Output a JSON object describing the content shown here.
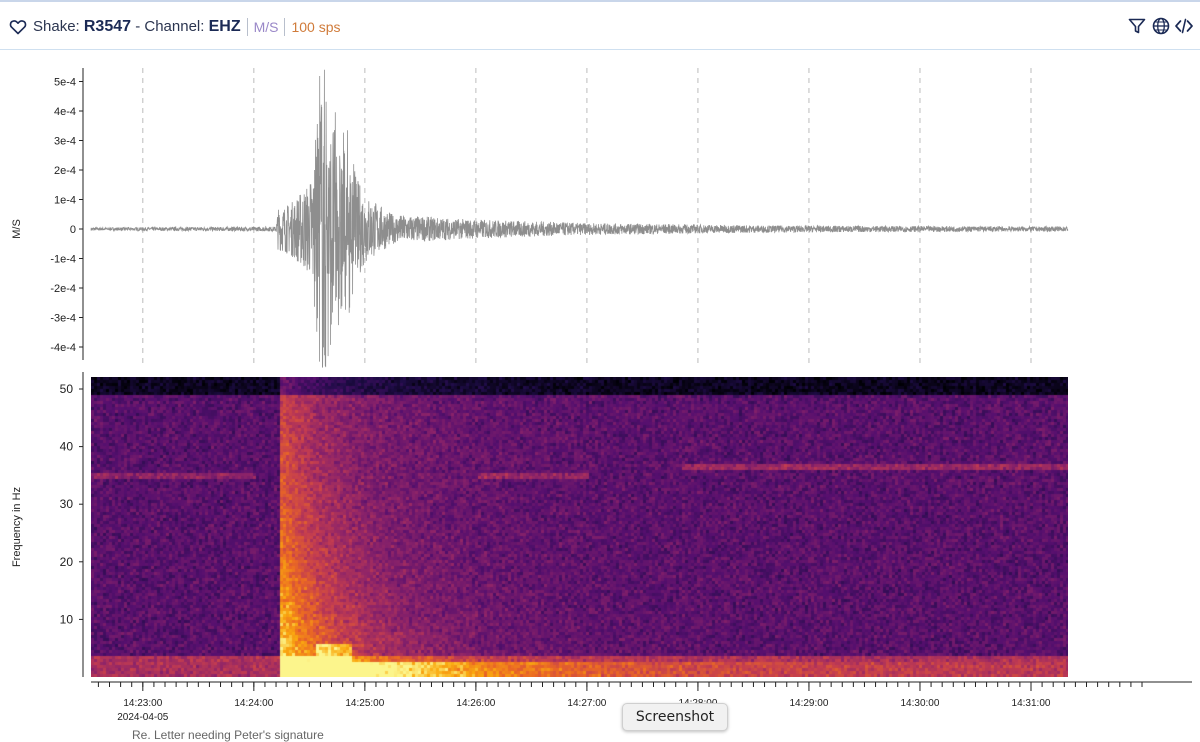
{
  "header": {
    "shake_label": "Shake:",
    "station": "R3547",
    "channel_label": "- Channel:",
    "channel": "EHZ",
    "unit": "M/S",
    "sample_rate": "100 sps"
  },
  "icons": {
    "favorite": "heart-icon",
    "filter": "filter-icon",
    "locate": "globe-icon",
    "embed": "code-icon"
  },
  "tooltip": "Screenshot",
  "bottom_partial_text": "Re. Letter needing Peter's signature",
  "colors": {
    "trace": "#8e8e8e",
    "grid": "#bcbcbc",
    "accent": "#1b2a55",
    "unit": "#9a88c8",
    "sps": "#d07b3a"
  },
  "chart_data": [
    {
      "type": "line",
      "ylabel": "M/S",
      "yticks": [
        "5e-4",
        "4e-4",
        "3e-4",
        "2e-4",
        "1e-4",
        "0",
        "-1e-4",
        "-2e-4",
        "-3e-4",
        "-4e-4"
      ],
      "ytick_values": [
        0.0005,
        0.0004,
        0.0003,
        0.0002,
        0.0001,
        0,
        -0.0001,
        -0.0002,
        -0.0003,
        -0.0004
      ],
      "ylim": [
        -0.00048,
        0.00055
      ],
      "x_range_seconds_after_14_22_00": [
        32,
        560
      ],
      "series": [
        {
          "envelope": [
            {
              "t": 32,
              "amp": 5e-06
            },
            {
              "t": 132,
              "amp": 8e-06
            },
            {
              "t": 133,
              "amp": 7e-05
            },
            {
              "t": 140,
              "amp": 9e-05
            },
            {
              "t": 150,
              "amp": 0.00016
            },
            {
              "t": 152,
              "amp": 0.00022
            },
            {
              "t": 155,
              "amp": 0.00045
            },
            {
              "t": 158,
              "amp": 0.00055
            },
            {
              "t": 162,
              "amp": 0.00035
            },
            {
              "t": 170,
              "amp": 0.00025
            },
            {
              "t": 180,
              "amp": 0.00012
            },
            {
              "t": 195,
              "amp": 5e-05
            },
            {
              "t": 230,
              "amp": 3.5e-05
            },
            {
              "t": 300,
              "amp": 2e-05
            },
            {
              "t": 400,
              "amp": 1.2e-05
            },
            {
              "t": 560,
              "amp": 8e-06
            }
          ]
        }
      ]
    },
    {
      "type": "heatmap",
      "ylabel": "Frequency in Hz",
      "yticks": [
        "50",
        "40",
        "30",
        "20",
        "10"
      ],
      "ytick_values": [
        50,
        40,
        30,
        20,
        10
      ],
      "ylim": [
        0,
        50
      ],
      "x_range_seconds_after_14_22_00": [
        32,
        560
      ],
      "colormap": "inferno",
      "event_onset_seconds": 133,
      "persistent_lines_hz": [
        36.5,
        35
      ],
      "xticks": [
        "14:23:00",
        "14:24:00",
        "14:25:00",
        "14:26:00",
        "14:27:00",
        "14:28:00",
        "14:29:00",
        "14:30:00",
        "14:31:00"
      ],
      "xtick_seconds": [
        60,
        120,
        180,
        240,
        300,
        360,
        420,
        480,
        540
      ],
      "date_label": "2024-04-05"
    }
  ]
}
